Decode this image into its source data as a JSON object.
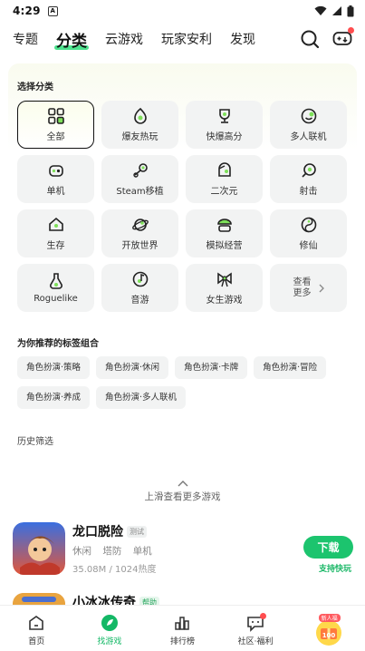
{
  "status_bar": {
    "time": "4:29",
    "badge": "A"
  },
  "top_nav": {
    "tabs": [
      {
        "label": "专题",
        "active": false
      },
      {
        "label": "分类",
        "active": true
      },
      {
        "label": "云游戏",
        "active": false
      },
      {
        "label": "玩家安利",
        "active": false
      },
      {
        "label": "发现",
        "active": false
      }
    ],
    "search_icon": "search-icon",
    "download_icon": "gamepad-download-icon"
  },
  "categories": {
    "title": "选择分类",
    "items": [
      {
        "label": "全部",
        "icon": "grid-icon",
        "selected": true
      },
      {
        "label": "爆友热玩",
        "icon": "hot-egg-icon"
      },
      {
        "label": "快爆高分",
        "icon": "trophy-icon"
      },
      {
        "label": "多人联机",
        "icon": "smile-icon"
      },
      {
        "label": "单机",
        "icon": "controller-icon"
      },
      {
        "label": "Steam移植",
        "icon": "steam-icon"
      },
      {
        "label": "二次元",
        "icon": "anime-icon"
      },
      {
        "label": "射击",
        "icon": "target-icon"
      },
      {
        "label": "生存",
        "icon": "house-icon"
      },
      {
        "label": "开放世界",
        "icon": "planet-icon"
      },
      {
        "label": "模拟经营",
        "icon": "cake-icon"
      },
      {
        "label": "修仙",
        "icon": "yin-yang-icon"
      },
      {
        "label": "Roguelike",
        "icon": "potion-icon"
      },
      {
        "label": "音游",
        "icon": "music-icon"
      },
      {
        "label": "女生游戏",
        "icon": "bow-icon"
      }
    ],
    "more_line1": "查看",
    "more_line2": "更多"
  },
  "recommended": {
    "title": "为你推荐的标签组合",
    "tags": [
      "角色扮演·策略",
      "角色扮演·休闲",
      "角色扮演·卡牌",
      "角色扮演·冒险",
      "角色扮演·养成",
      "角色扮演·多人联机"
    ]
  },
  "history": {
    "title": "历史筛选"
  },
  "pull_hint": "上滑查看更多游戏",
  "games": [
    {
      "name": "龙口脱险",
      "badge": "测试",
      "tags": [
        "休闲",
        "塔防",
        "单机"
      ],
      "size": "35.08M",
      "separator": "/",
      "heat": "1024热度",
      "button": "下载",
      "sub": "支持快玩"
    },
    {
      "name": "小冰冰传奇",
      "badge": "帮助"
    }
  ],
  "bottom_nav": [
    {
      "label": "首页",
      "icon": "home-icon"
    },
    {
      "label": "找游戏",
      "icon": "find-game-icon",
      "active": true
    },
    {
      "label": "排行榜",
      "icon": "chart-icon"
    },
    {
      "label": "社区·福利",
      "icon": "community-icon",
      "dot": true
    },
    {
      "label": "",
      "icon": "newcomer-gift-icon",
      "pill": "新人福"
    }
  ],
  "colors": {
    "accent": "#1cc46e",
    "highlight": "#4ce28d",
    "red": "#ff4d4f"
  }
}
